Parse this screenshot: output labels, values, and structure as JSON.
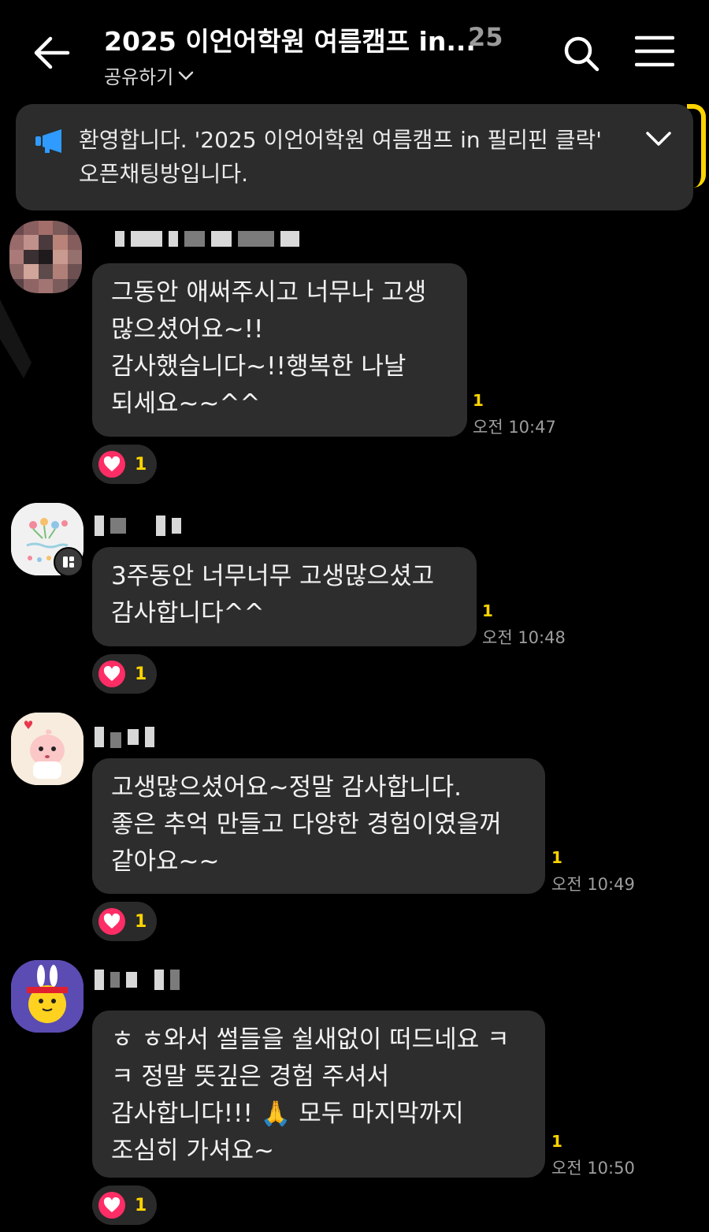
{
  "header": {
    "title": "2025 이언어학원 여름캠프 in...",
    "member_count": "25",
    "share_label": "공유하기"
  },
  "notice": {
    "text": "환영합니다. '2025 이언어학원 여름캠프 in 필리핀 클락' 오픈채팅방입니다."
  },
  "messages": [
    {
      "text": "그동안 애써주시고 너무나 고생\n많으셨어요~!!\n감사했습니다~!!행복한 나날\n되세요~~^^",
      "unread": "1",
      "time": "오전 10:47",
      "reaction_count": "1"
    },
    {
      "text": "3주동안 너무너무 고생많으셨고\n감사합니다^^",
      "unread": "1",
      "time": "오전 10:48",
      "reaction_count": "1"
    },
    {
      "text": "고생많으셨어요~정말 감사합니다.\n좋은 추억 만들고 다양한 경험이였을꺼\n같아요~~",
      "unread": "1",
      "time": "오전 10:49",
      "reaction_count": "1"
    },
    {
      "text": "ㅎ ㅎ와서 썰들을 쉴새없이 떠드네요 ㅋ\nㅋ 정말 뜻깊은 경험 주셔서\n감사합니다!!! 🙏 모두 마지막까지\n조심히 가셔요~",
      "unread": "1",
      "time": "오전 10:50",
      "reaction_count": "1"
    }
  ],
  "colors": {
    "background": "#000000",
    "bubble": "#2d2d2d",
    "unread": "#ffd400",
    "heart": "#ff2d66",
    "notice_icon": "#2f9bff"
  },
  "icons": [
    "back-arrow-icon",
    "search-icon",
    "menu-icon",
    "megaphone-icon",
    "chevron-down-icon",
    "heart-icon"
  ]
}
